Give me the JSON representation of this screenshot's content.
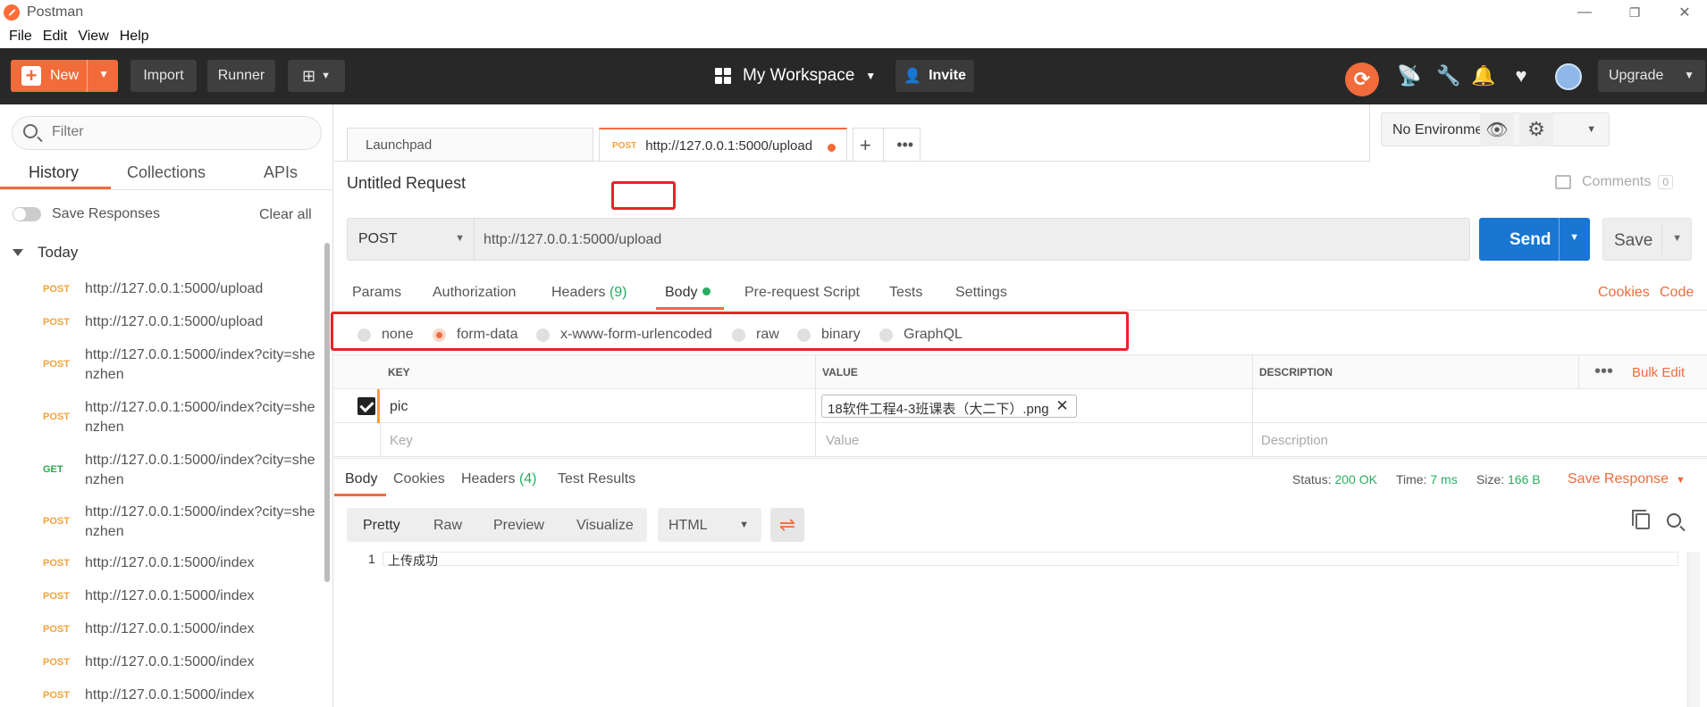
{
  "window": {
    "title": "Postman",
    "minimize": "—",
    "restore": "❐",
    "close": "✕"
  },
  "menu": [
    "File",
    "Edit",
    "View",
    "Help"
  ],
  "header": {
    "new_label": "New",
    "import_label": "Import",
    "runner_label": "Runner",
    "workspace_label": "My Workspace",
    "invite_label": "Invite",
    "upgrade_label": "Upgrade"
  },
  "sidebar": {
    "filter_placeholder": "Filter",
    "tabs": [
      "History",
      "Collections",
      "APIs"
    ],
    "save_responses_label": "Save Responses",
    "clear_all_label": "Clear all",
    "group_label": "Today",
    "items": [
      {
        "method": "POST",
        "url": "http://127.0.0.1:5000/upload"
      },
      {
        "method": "POST",
        "url": "http://127.0.0.1:5000/upload"
      },
      {
        "method": "POST",
        "url": "http://127.0.0.1:5000/index?city=shenzhen"
      },
      {
        "method": "POST",
        "url": "http://127.0.0.1:5000/index?city=shenzhen"
      },
      {
        "method": "GET",
        "url": "http://127.0.0.1:5000/index?city=shenzhen"
      },
      {
        "method": "POST",
        "url": "http://127.0.0.1:5000/index?city=shenzhen"
      },
      {
        "method": "POST",
        "url": "http://127.0.0.1:5000/index"
      },
      {
        "method": "POST",
        "url": "http://127.0.0.1:5000/index"
      },
      {
        "method": "POST",
        "url": "http://127.0.0.1:5000/index"
      },
      {
        "method": "POST",
        "url": "http://127.0.0.1:5000/index"
      },
      {
        "method": "POST",
        "url": "http://127.0.0.1:5000/index"
      }
    ]
  },
  "tabs": {
    "launchpad_label": "Launchpad",
    "active_method": "POST",
    "active_url": "http://127.0.0.1:5000/upload"
  },
  "environment": {
    "selected": "No Environment"
  },
  "request": {
    "title": "Untitled Request",
    "comments_label": "Comments",
    "comments_count": "0",
    "method": "POST",
    "url": "http://127.0.0.1:5000/upload",
    "send_label": "Send",
    "save_label": "Save",
    "tabs": {
      "params": "Params",
      "authorization": "Authorization",
      "headers": "Headers",
      "headers_count": "(9)",
      "body": "Body",
      "prerequest": "Pre-request Script",
      "tests": "Tests",
      "settings": "Settings"
    },
    "cookies_label": "Cookies",
    "code_label": "Code",
    "body_modes": [
      "none",
      "form-data",
      "x-www-form-urlencoded",
      "raw",
      "binary",
      "GraphQL"
    ],
    "body_mode_selected": "form-data",
    "table_headers": {
      "key": "KEY",
      "value": "VALUE",
      "description": "DESCRIPTION"
    },
    "bulk_edit_label": "Bulk Edit",
    "rows": [
      {
        "key": "pic",
        "value": "18软件工程4-3班课表（大二下）.png"
      }
    ],
    "placeholders": {
      "key": "Key",
      "value": "Value",
      "description": "Description"
    }
  },
  "response": {
    "tabs": {
      "body": "Body",
      "cookies": "Cookies",
      "headers": "Headers",
      "headers_count": "(4)",
      "test_results": "Test Results"
    },
    "status_label": "Status:",
    "status_value": "200 OK",
    "time_label": "Time:",
    "time_value": "7 ms",
    "size_label": "Size:",
    "size_value": "166 B",
    "save_response_label": "Save Response",
    "formats": [
      "Pretty",
      "Raw",
      "Preview",
      "Visualize"
    ],
    "language": "HTML",
    "line_number": "1",
    "content": "上传成功"
  },
  "colors": {
    "accent": "#f26b3a",
    "send": "#1976d2",
    "success": "#27ae60",
    "post": "#f4a23a",
    "annotation": "#e8232a"
  }
}
